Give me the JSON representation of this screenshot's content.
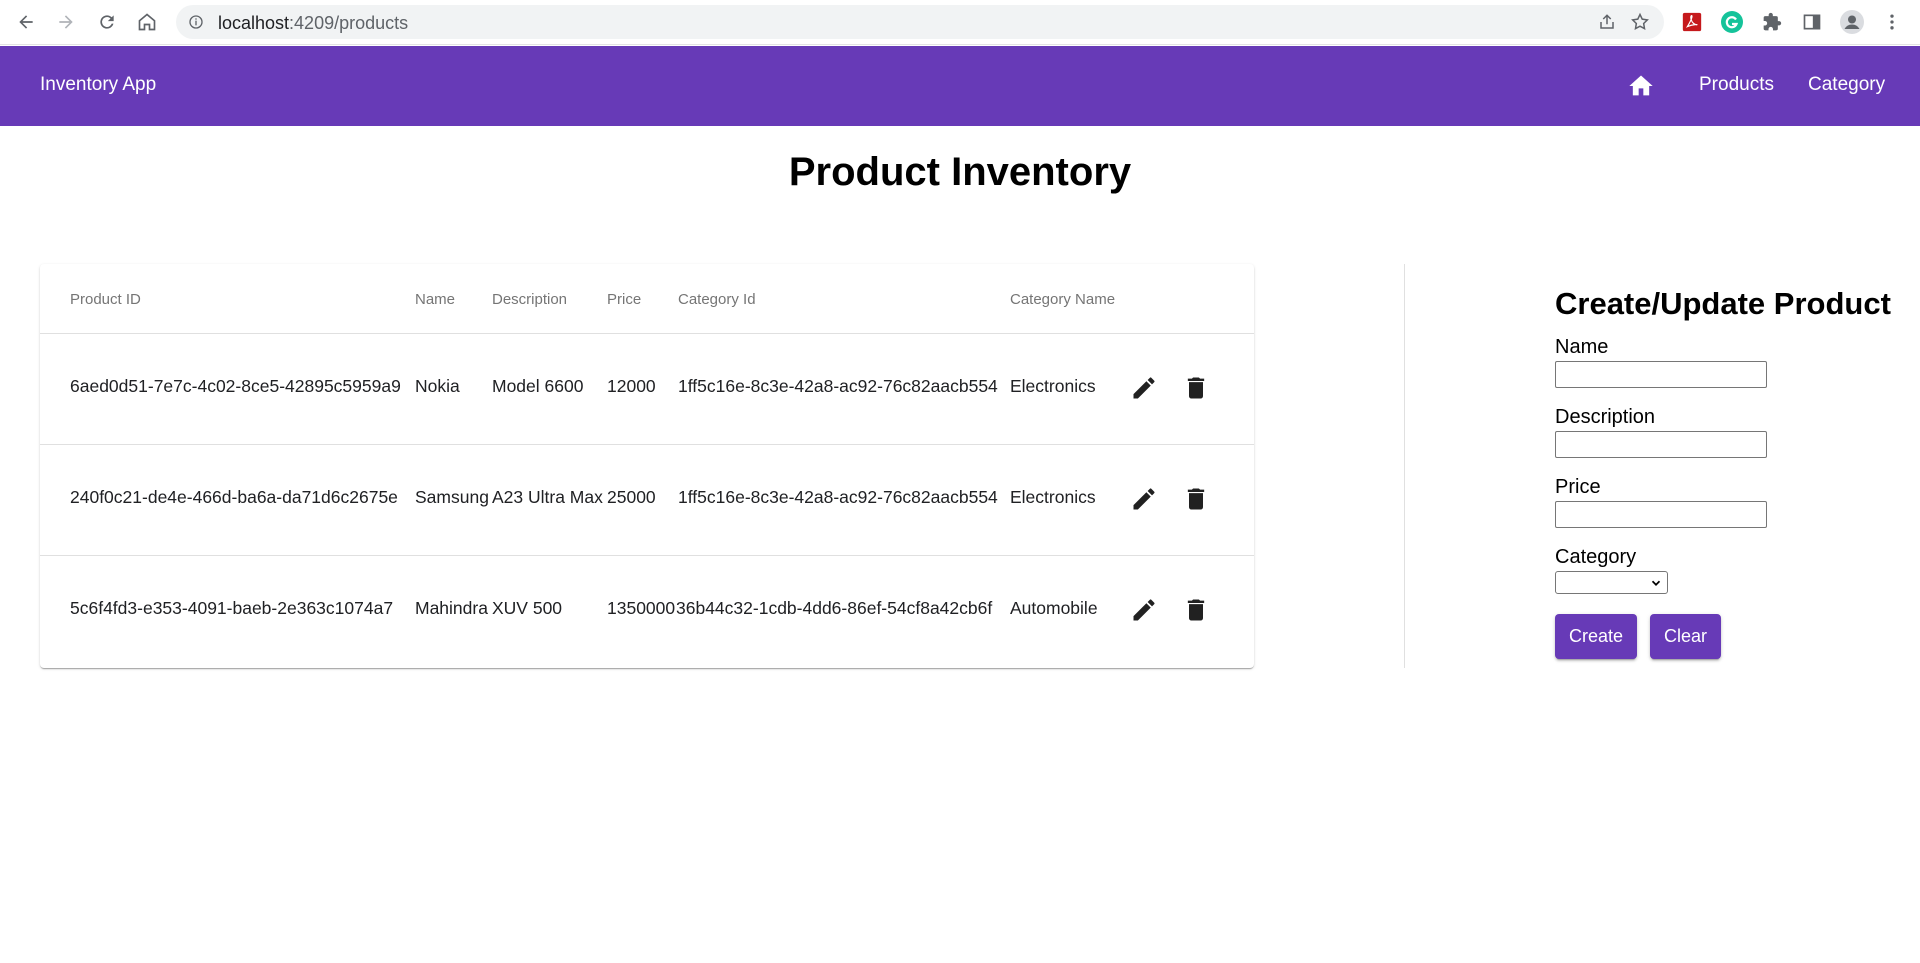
{
  "browser": {
    "url_host": "localhost",
    "url_path": ":4209/products"
  },
  "toolbar": {
    "app_title": "Inventory App",
    "nav_products": "Products",
    "nav_category": "Category",
    "color": "#673ab7"
  },
  "main": {
    "title": "Product Inventory"
  },
  "table": {
    "headers": [
      "Product ID",
      "Name",
      "Description",
      "Price",
      "Category Id",
      "Category Name"
    ],
    "rows": [
      [
        "6aed0d51-7e7c-4c02-8ce5-42895c5959a9",
        "Nokia",
        "Model 6600",
        "12000",
        "1ff5c16e-8c3e-42a8-ac92-76c82aacb554",
        "Electronics"
      ],
      [
        "240f0c21-de4e-466d-ba6a-da71d6c2675e",
        "Samsung",
        "A23 Ultra Max",
        "25000",
        "1ff5c16e-8c3e-42a8-ac92-76c82aacb554",
        "Electronics"
      ],
      [
        "5c6f4fd3-e353-4091-baeb-2e363c1074a7",
        "Mahindra",
        "XUV 500",
        "1350000",
        "36b44c32-1cdb-4dd6-86ef-54cf8a42cb6f",
        "Automobile"
      ]
    ],
    "row_actions": [
      "edit-icon",
      "delete-icon"
    ]
  },
  "form": {
    "title": "Create/Update Product",
    "name_label": "Name",
    "name_value": "",
    "description_label": "Description",
    "description_value": "",
    "price_label": "Price",
    "price_value": "",
    "category_label": "Category",
    "category_value": "",
    "create_label": "Create",
    "clear_label": "Clear"
  }
}
